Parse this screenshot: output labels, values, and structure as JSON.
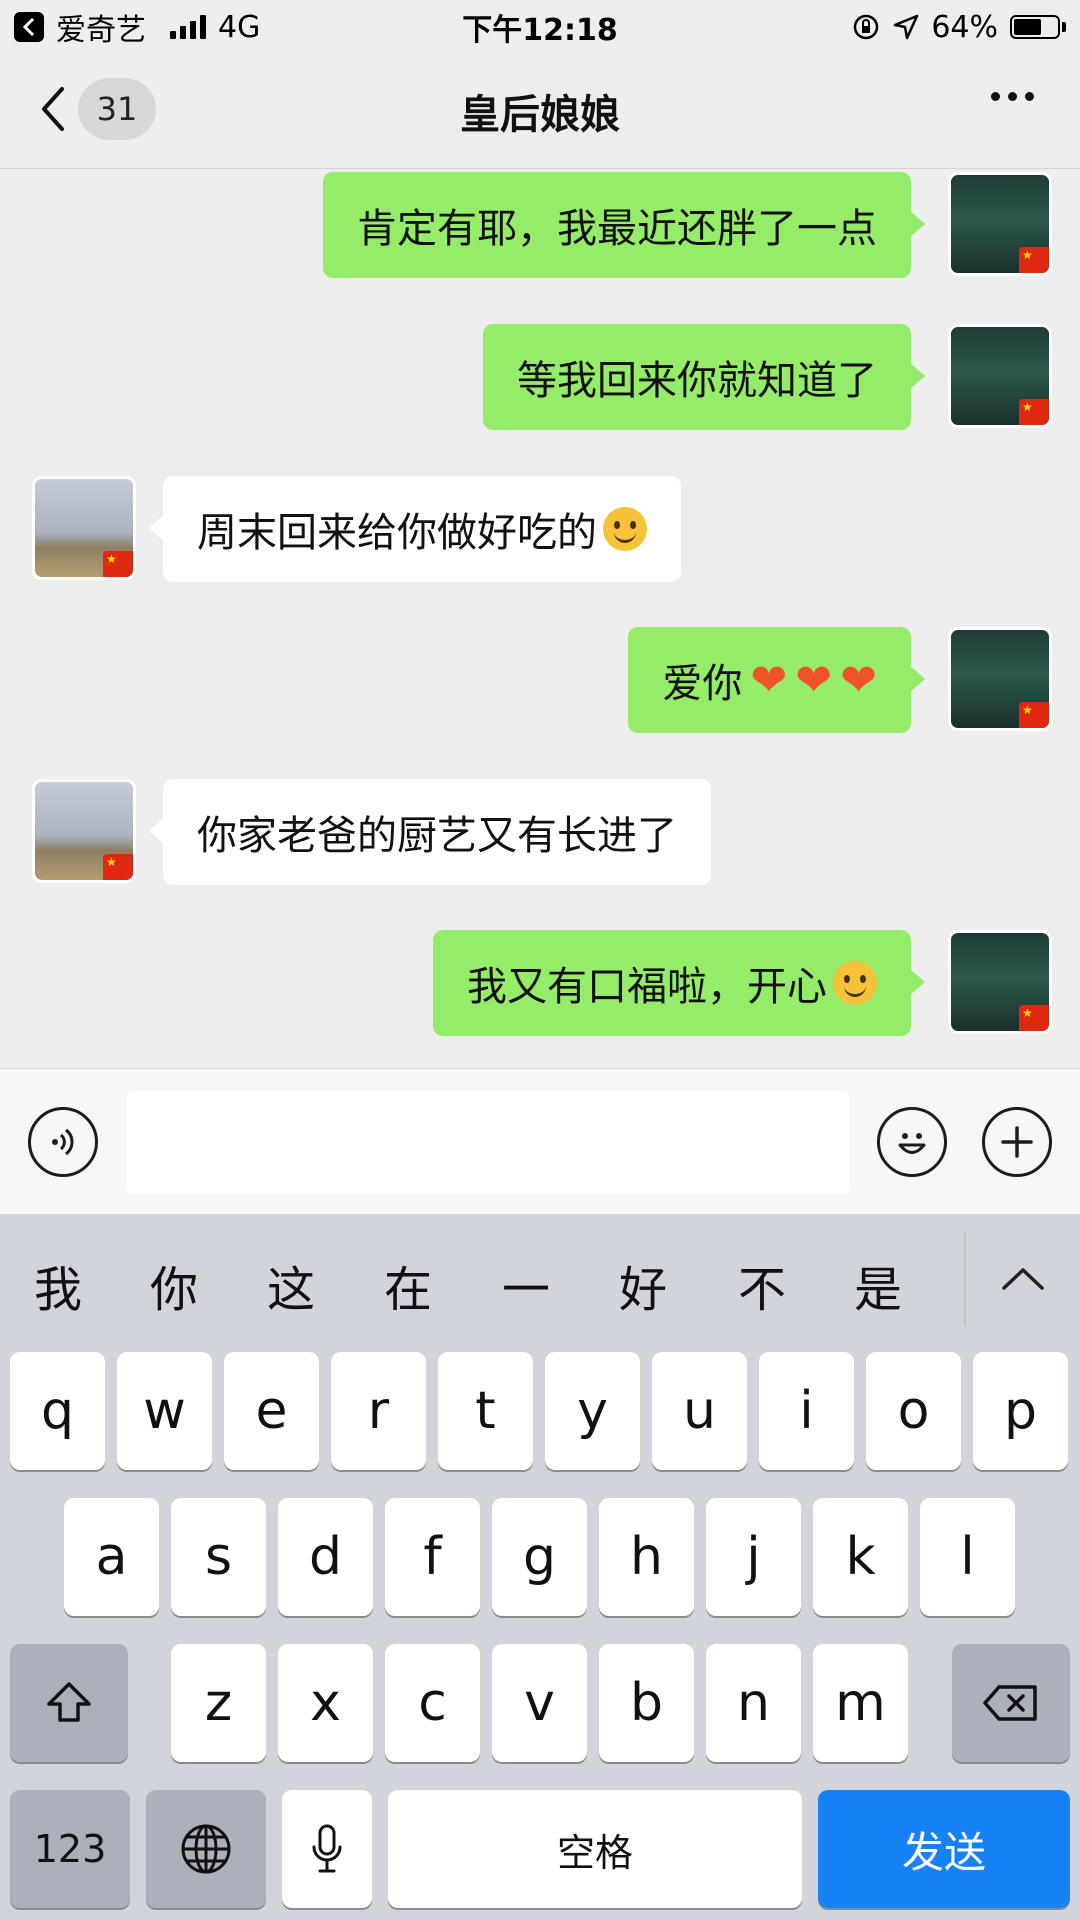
{
  "status_bar": {
    "back_app": "爱奇艺",
    "network": "4G",
    "time": "下午12:18",
    "battery": "64%"
  },
  "nav": {
    "unread_count": "31",
    "title": "皇后娘娘"
  },
  "messages": [
    {
      "side": "me",
      "text": "肯定有耶，我最近还胖了一点",
      "emoji": ""
    },
    {
      "side": "me",
      "text": "等我回来你就知道了",
      "emoji": ""
    },
    {
      "side": "them",
      "text": "周末回来给你做好吃的",
      "emoji": "slightly-smiling-face"
    },
    {
      "side": "me",
      "text": "爱你",
      "emoji": "hearts",
      "hearts": [
        "❤",
        "❤",
        "❤"
      ]
    },
    {
      "side": "them",
      "text": "你家老爸的厨艺又有长进了",
      "emoji": ""
    },
    {
      "side": "me",
      "text": "我又有口福啦，开心",
      "emoji": "grinning-face"
    }
  ],
  "input": {
    "value": "",
    "placeholder": ""
  },
  "keyboard": {
    "candidates": [
      "我",
      "你",
      "这",
      "在",
      "一",
      "好",
      "不",
      "是"
    ],
    "row1": [
      "q",
      "w",
      "e",
      "r",
      "t",
      "y",
      "u",
      "i",
      "o",
      "p"
    ],
    "row2": [
      "a",
      "s",
      "d",
      "f",
      "g",
      "h",
      "j",
      "k",
      "l"
    ],
    "row3": [
      "z",
      "x",
      "c",
      "v",
      "b",
      "n",
      "m"
    ],
    "num_key": "123",
    "space_key": "空格",
    "send_key": "发送"
  },
  "colors": {
    "my_bubble": "#95ec69",
    "their_bubble": "#ffffff",
    "send_key": "#1682f5",
    "heart": "#f0522a"
  }
}
